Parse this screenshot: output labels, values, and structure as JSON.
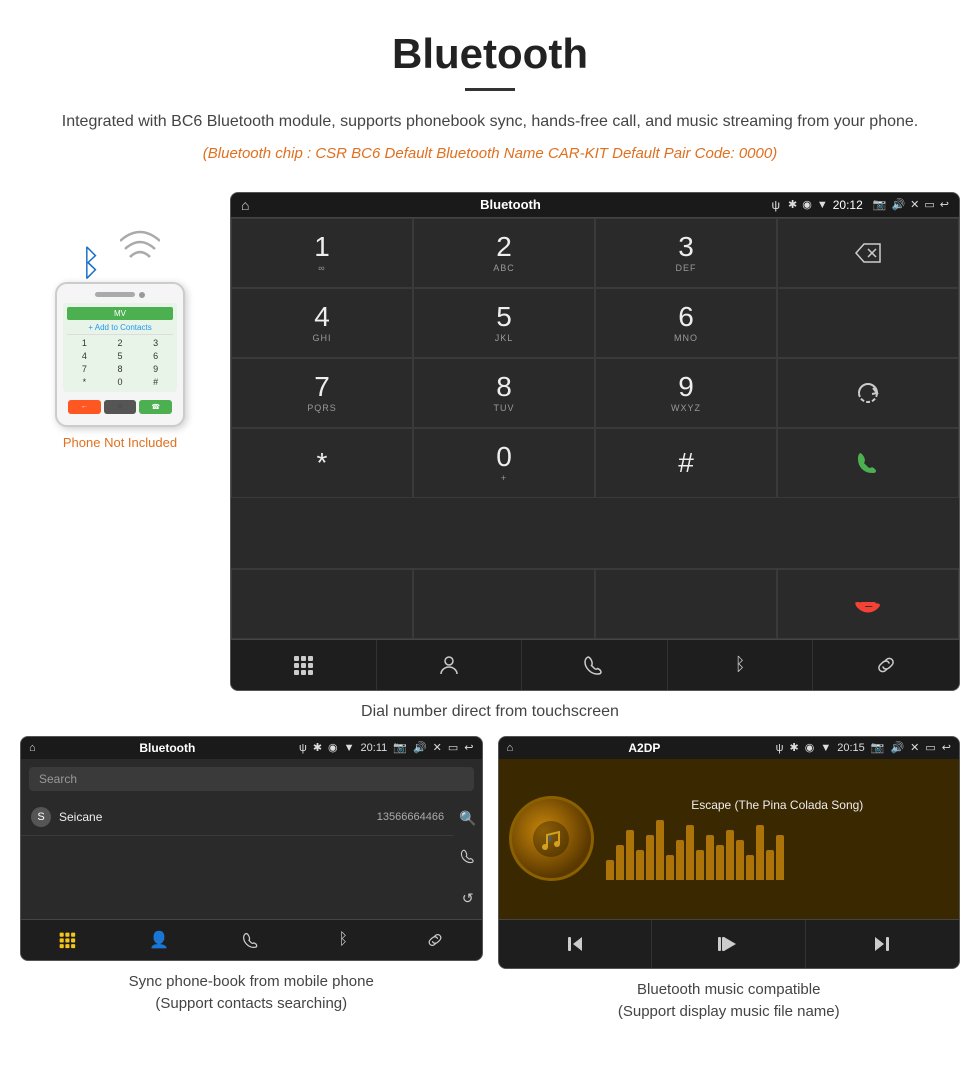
{
  "header": {
    "title": "Bluetooth",
    "description": "Integrated with BC6 Bluetooth module, supports phonebook sync, hands-free call, and music streaming from your phone.",
    "chip_info": "(Bluetooth chip : CSR BC6    Default Bluetooth Name CAR-KIT    Default Pair Code: 0000)"
  },
  "phone_illustration": {
    "not_included": "Phone Not Included",
    "add_contact": "+ Add to Contacts",
    "keys": [
      "1",
      "2",
      "3",
      "4",
      "5",
      "6",
      "7",
      "8",
      "9",
      "*",
      "0",
      "#"
    ]
  },
  "dialpad_screen": {
    "status_bar": {
      "home": "⌂",
      "title": "Bluetooth",
      "usb": "ψ",
      "time": "20:12"
    },
    "keys": [
      {
        "num": "1",
        "letters": "∞"
      },
      {
        "num": "2",
        "letters": "ABC"
      },
      {
        "num": "3",
        "letters": "DEF"
      },
      {
        "num": "",
        "letters": ""
      },
      {
        "num": "4",
        "letters": "GHI"
      },
      {
        "num": "5",
        "letters": "JKL"
      },
      {
        "num": "6",
        "letters": "MNO"
      },
      {
        "num": "",
        "letters": ""
      },
      {
        "num": "7",
        "letters": "PQRS"
      },
      {
        "num": "8",
        "letters": "TUV"
      },
      {
        "num": "9",
        "letters": "WXYZ"
      },
      {
        "num": "",
        "letters": ""
      },
      {
        "num": "*",
        "letters": ""
      },
      {
        "num": "0",
        "letters": "+"
      },
      {
        "num": "#",
        "letters": ""
      },
      {
        "num": "",
        "letters": ""
      }
    ],
    "bottom_icons": [
      "⊞",
      "👤",
      "☎",
      "✱",
      "⛓"
    ],
    "caption": "Dial number direct from touchscreen"
  },
  "contacts_screen": {
    "status_bar": {
      "home": "⌂",
      "title": "Bluetooth",
      "usb": "ψ",
      "time": "20:11"
    },
    "search_placeholder": "Search",
    "contacts": [
      {
        "initial": "S",
        "name": "Seicane",
        "phone": "13566664466"
      }
    ],
    "caption_line1": "Sync phone-book from mobile phone",
    "caption_line2": "(Support contacts searching)"
  },
  "music_screen": {
    "status_bar": {
      "home": "⌂",
      "title": "A2DP",
      "usb": "ψ",
      "time": "20:15"
    },
    "song_title": "Escape (The Pina Colada Song)",
    "visualizer_heights": [
      20,
      35,
      50,
      30,
      45,
      60,
      25,
      40,
      55,
      30,
      45,
      35,
      50,
      40,
      25,
      55,
      30,
      45
    ],
    "caption_line1": "Bluetooth music compatible",
    "caption_line2": "(Support display music file name)"
  },
  "colors": {
    "orange": "#e07020",
    "green": "#4caf50",
    "red": "#f44336",
    "blue_bt": "#1a6fc4",
    "screen_bg": "#2a2a2a",
    "status_bg": "#1a1a1a"
  }
}
